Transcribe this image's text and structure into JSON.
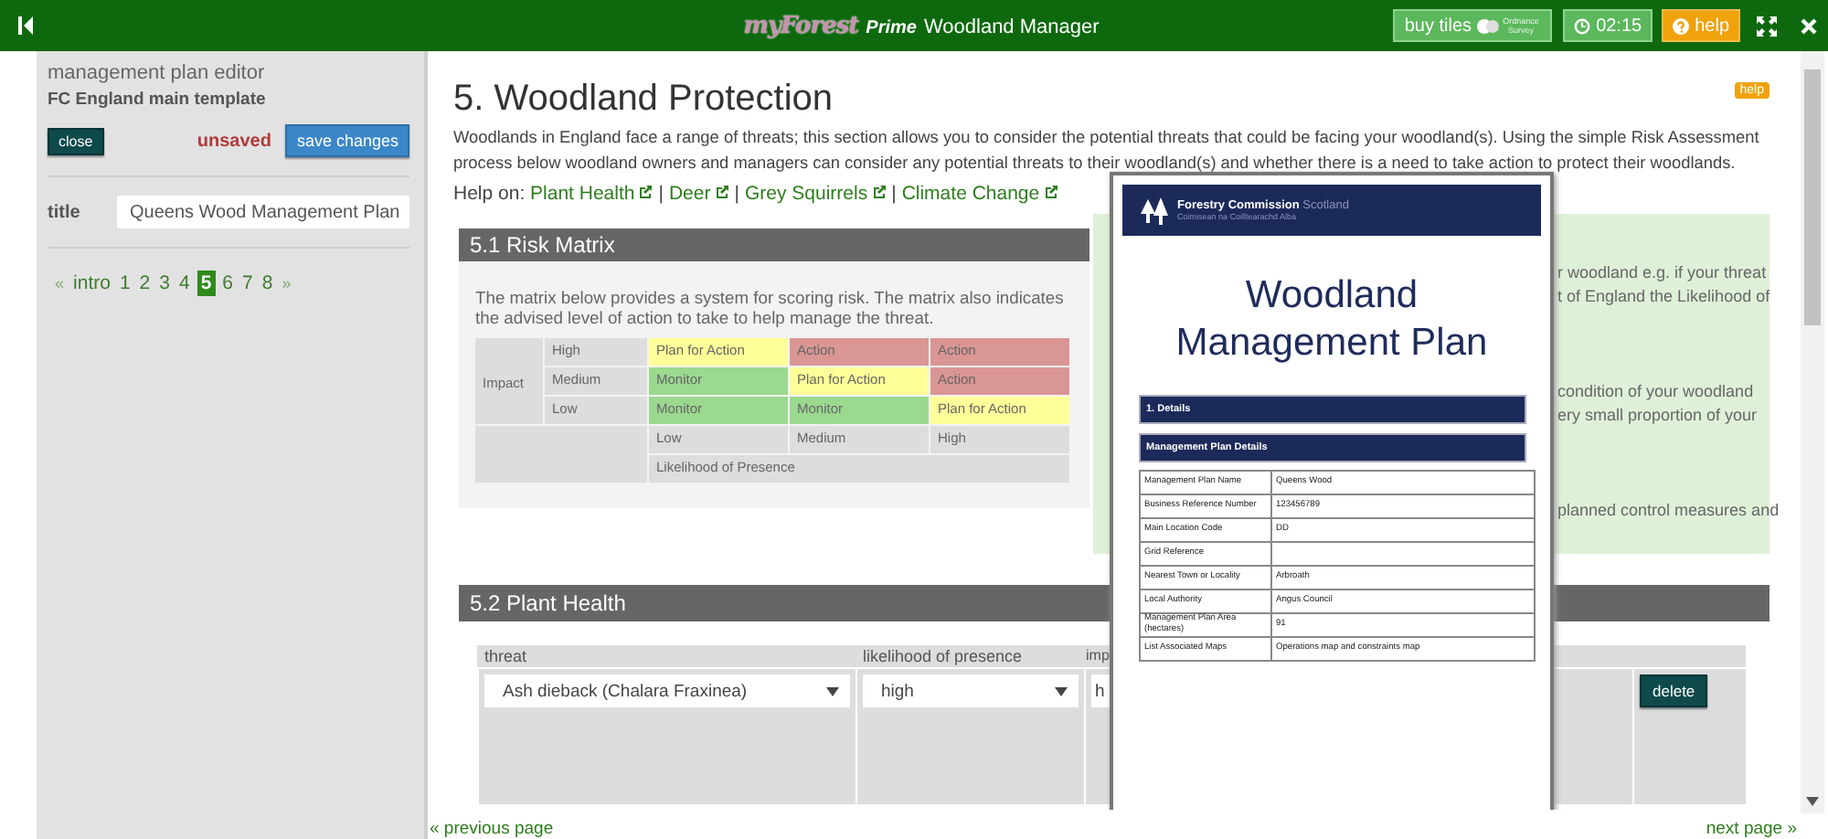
{
  "topbar": {
    "brand": "myForest",
    "edition": "Prime",
    "title": "Woodland Manager",
    "buy_tiles": "buy tiles",
    "os_logo_text": "Ordnance Survey",
    "timer": "02:15",
    "help": "help"
  },
  "sidebar": {
    "heading": "management plan editor",
    "template": "FC England main template",
    "close": "close",
    "status": "unsaved",
    "save": "save changes",
    "title_label": "title",
    "title_value": "Queens Wood Management Plan",
    "pager": [
      {
        "label": "«",
        "kind": "arrow",
        "selected": false
      },
      {
        "label": "intro",
        "kind": "page",
        "selected": false
      },
      {
        "label": "1",
        "kind": "page",
        "selected": false
      },
      {
        "label": "2",
        "kind": "page",
        "selected": false
      },
      {
        "label": "3",
        "kind": "page",
        "selected": false
      },
      {
        "label": "4",
        "kind": "page",
        "selected": false
      },
      {
        "label": "5",
        "kind": "page",
        "selected": true
      },
      {
        "label": "6",
        "kind": "page",
        "selected": false
      },
      {
        "label": "7",
        "kind": "page",
        "selected": false
      },
      {
        "label": "8",
        "kind": "page",
        "selected": false
      },
      {
        "label": "»",
        "kind": "arrow",
        "selected": false
      }
    ]
  },
  "main": {
    "heading": "5. Woodland Protection",
    "help": "help",
    "intro": "Woodlands in England face a range of threats; this section allows you to consider the potential threats that could be facing your woodland(s). Using the simple Risk Assessment process below woodland owners and managers can consider any potential threats to their woodland(s) and whether there is a need to take action to protect their woodlands.",
    "help_on": {
      "label": "Help on:",
      "links": [
        {
          "label": "Plant Health"
        },
        {
          "label": "Deer",
          "separator": "|"
        },
        {
          "label": "Grey Squirrels",
          "separator": "|"
        },
        {
          "label": "Climate Change",
          "separator": "|"
        }
      ]
    }
  },
  "risk_matrix": {
    "title": "5.1 Risk Matrix",
    "description": "The matrix below provides a system for scoring risk. The matrix also indicates the advised level of action to take to help manage the threat.",
    "rows": [
      {
        "label": "High",
        "cells": [
          {
            "text": "Plan for Action",
            "color": "#ffff99"
          },
          {
            "text": "Action",
            "color": "#da9694"
          },
          {
            "text": "Action",
            "color": "#da9694"
          }
        ]
      },
      {
        "label": "Medium",
        "cells": [
          {
            "text": "Monitor",
            "color": "#9bd98f"
          },
          {
            "text": "Plan for Action",
            "color": "#ffff99"
          },
          {
            "text": "Action",
            "color": "#da9694"
          }
        ]
      },
      {
        "label": "Low",
        "cells": [
          {
            "text": "Monitor",
            "color": "#9bd98f"
          },
          {
            "text": "Monitor",
            "color": "#9bd98f"
          },
          {
            "text": "Plan for Action",
            "color": "#ffff99"
          }
        ]
      }
    ],
    "axis_label": "Impact",
    "likelihood_levels": [
      "Low",
      "Medium",
      "High"
    ],
    "likelihood_title": "Likelihood of Presence"
  },
  "guidance": [
    [
      "r woodland e.g. if your threat",
      "t of England the Likelihood of"
    ],
    [
      "condition of your woodland",
      "ery small proportion of your"
    ],
    [
      "planned control measures and"
    ]
  ],
  "plant_health": {
    "title": "5.2 Plant Health",
    "columns": [
      "threat",
      "likelihood of presence",
      "imp"
    ],
    "rows": [
      {
        "fields": [
          {
            "value": "Ash dieback (Chalara Fraxinea)",
            "caret": true
          },
          {
            "value": "high",
            "caret": true
          },
          {
            "value": "h",
            "caret": false
          }
        ],
        "delete": "delete"
      }
    ]
  },
  "document_preview": {
    "org": "Forestry Commission",
    "org_region": "Scotland",
    "org_gaelic": "Coimisean na Coilltearachd Alba",
    "title_lines": [
      "Woodland",
      "Management Plan"
    ],
    "section": "1. Details",
    "subsection": "Management Plan Details",
    "rows": [
      {
        "label": "Management Plan Name",
        "value": "Queens Wood"
      },
      {
        "label": "Business Reference Number",
        "value": "123456789"
      },
      {
        "label": "Main Location Code",
        "value": "DD"
      },
      {
        "label": "Grid Reference"
      },
      {
        "label": "Nearest Town or Locality",
        "value": "Arbroath"
      },
      {
        "label": "Local Authority",
        "value": "Angus Council"
      },
      {
        "label": "Management Plan Area (hectares)",
        "value": "91"
      },
      {
        "label": "List Associated Maps",
        "value": "Operations map and constraints map"
      }
    ]
  },
  "footer": {
    "previous": "« previous page",
    "next": "next page »"
  }
}
